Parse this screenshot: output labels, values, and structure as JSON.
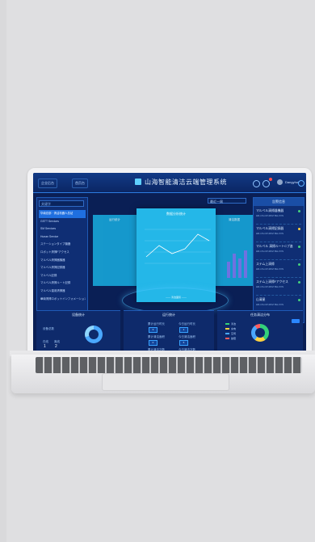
{
  "header": {
    "title": "山海智能清洁云端管理系统",
    "left_pills": [
      "企业后台",
      "首页台"
    ],
    "username": "Dangyhui"
  },
  "sidebar": {
    "search_placeholder": "关键字",
    "items": [
      "华南总部 · 清洁机器人总站",
      "GSTT Services",
      "SM Services",
      "Hunan Service",
      "ステーションタイプ機器",
      "ロボット清掃Fアクセス",
      "マルベル清掃器機器",
      "マルベル清掃記録器",
      "マルベル記録",
      "マルベル清掃ルート記録",
      "マルベル運用清掃器",
      "華南清掃ロボットインフォメーション"
    ]
  },
  "middle": {
    "select_value": "最近一周",
    "card_left_title": "运行统计",
    "card_main_title": "数据分析统计",
    "card_right_title": "清洁数据",
    "card_main_footer": "—— 清洁面积 ——",
    "chart_line_color": "#ffffff",
    "chart_bar_color": "#7a7cf0"
  },
  "right_panel": {
    "title": "告警信息",
    "items": [
      {
        "name": "マルベル清掃器機器",
        "time": "HR-CS-CP-MXZ BH-VVS",
        "state": "green"
      },
      {
        "name": "マルベル清掃記録器",
        "time": "HR-CS-CP-MXZ BH-VVS",
        "state": "yellow"
      },
      {
        "name": "マルベル 清掃ルートCプ進",
        "time": "HR-CS-CP-MXZ BH-VVS",
        "state": "green"
      },
      {
        "name": "ステム上清掃",
        "time": "HR-CS-CP-MXZ BH-VVS",
        "state": "green"
      },
      {
        "name": "ステム上清掃Fアクセス",
        "time": "HR-CS-CP-MXZ BH-VVS",
        "state": "green"
      },
      {
        "name": "山清屋",
        "time": "HR-CS-CP-MXZ BH-VVS",
        "state": "green"
      }
    ]
  },
  "bottom_left": {
    "title": "设备统计",
    "device_label": "设备总数",
    "online_label": "在线",
    "offline_label": "离线",
    "online_val": "1",
    "offline_val": "2"
  },
  "bottom_middle": {
    "title": "运行统计",
    "stats": [
      {
        "label": "累计运行时长",
        "value": "3"
      },
      {
        "label": "今日运行时长",
        "value": "1"
      },
      {
        "label": "累计清洁面积",
        "value": "0"
      },
      {
        "label": "今日清洁面积",
        "value": "5"
      },
      {
        "label": "累计清洁次数",
        "value": "0"
      },
      {
        "label": "今日清洁次数",
        "value": "0"
      }
    ]
  },
  "bottom_right": {
    "title": "任务清洁分布",
    "legend": [
      "清洁",
      "充电",
      "空闲",
      "故障"
    ],
    "legend_colors": [
      "#33d17a",
      "#ffd23f",
      "#4aa8ff",
      "#ff5d5d"
    ]
  }
}
